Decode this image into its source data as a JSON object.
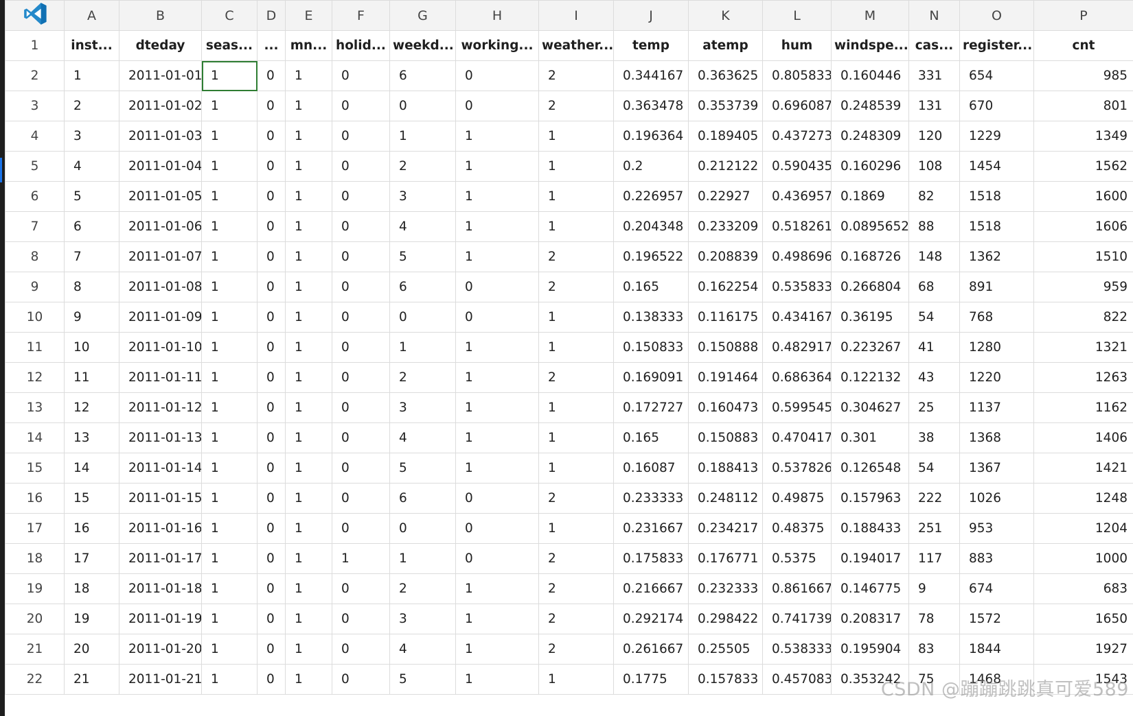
{
  "app_icon": "vscode-logo-icon",
  "accent_color": "#1a73e8",
  "selection_color": "#2e7d32",
  "columns": [
    "A",
    "B",
    "C",
    "D",
    "E",
    "F",
    "G",
    "H",
    "I",
    "J",
    "K",
    "L",
    "M",
    "N",
    "O",
    "P"
  ],
  "headers": [
    "inst...",
    "dteday",
    "seas...",
    "...",
    "mn...",
    "holid...",
    "weekd...",
    "working...",
    "weather...",
    "temp",
    "atemp",
    "hum",
    "windspe...",
    "cas...",
    "register...",
    "cnt"
  ],
  "rows": [
    [
      "1",
      "2011-01-01",
      "1",
      "0",
      "1",
      "0",
      "6",
      "0",
      "2",
      "0.344167",
      "0.363625",
      "0.805833",
      "0.160446",
      "331",
      "654",
      "985"
    ],
    [
      "2",
      "2011-01-02",
      "1",
      "0",
      "1",
      "0",
      "0",
      "0",
      "2",
      "0.363478",
      "0.353739",
      "0.696087",
      "0.248539",
      "131",
      "670",
      "801"
    ],
    [
      "3",
      "2011-01-03",
      "1",
      "0",
      "1",
      "0",
      "1",
      "1",
      "1",
      "0.196364",
      "0.189405",
      "0.437273",
      "0.248309",
      "120",
      "1229",
      "1349"
    ],
    [
      "4",
      "2011-01-04",
      "1",
      "0",
      "1",
      "0",
      "2",
      "1",
      "1",
      "0.2",
      "0.212122",
      "0.590435",
      "0.160296",
      "108",
      "1454",
      "1562"
    ],
    [
      "5",
      "2011-01-05",
      "1",
      "0",
      "1",
      "0",
      "3",
      "1",
      "1",
      "0.226957",
      "0.22927",
      "0.436957",
      "0.1869",
      "82",
      "1518",
      "1600"
    ],
    [
      "6",
      "2011-01-06",
      "1",
      "0",
      "1",
      "0",
      "4",
      "1",
      "1",
      "0.204348",
      "0.233209",
      "0.518261",
      "0.0895652",
      "88",
      "1518",
      "1606"
    ],
    [
      "7",
      "2011-01-07",
      "1",
      "0",
      "1",
      "0",
      "5",
      "1",
      "2",
      "0.196522",
      "0.208839",
      "0.498696",
      "0.168726",
      "148",
      "1362",
      "1510"
    ],
    [
      "8",
      "2011-01-08",
      "1",
      "0",
      "1",
      "0",
      "6",
      "0",
      "2",
      "0.165",
      "0.162254",
      "0.535833",
      "0.266804",
      "68",
      "891",
      "959"
    ],
    [
      "9",
      "2011-01-09",
      "1",
      "0",
      "1",
      "0",
      "0",
      "0",
      "1",
      "0.138333",
      "0.116175",
      "0.434167",
      "0.36195",
      "54",
      "768",
      "822"
    ],
    [
      "10",
      "2011-01-10",
      "1",
      "0",
      "1",
      "0",
      "1",
      "1",
      "1",
      "0.150833",
      "0.150888",
      "0.482917",
      "0.223267",
      "41",
      "1280",
      "1321"
    ],
    [
      "11",
      "2011-01-11",
      "1",
      "0",
      "1",
      "0",
      "2",
      "1",
      "2",
      "0.169091",
      "0.191464",
      "0.686364",
      "0.122132",
      "43",
      "1220",
      "1263"
    ],
    [
      "12",
      "2011-01-12",
      "1",
      "0",
      "1",
      "0",
      "3",
      "1",
      "1",
      "0.172727",
      "0.160473",
      "0.599545",
      "0.304627",
      "25",
      "1137",
      "1162"
    ],
    [
      "13",
      "2011-01-13",
      "1",
      "0",
      "1",
      "0",
      "4",
      "1",
      "1",
      "0.165",
      "0.150883",
      "0.470417",
      "0.301",
      "38",
      "1368",
      "1406"
    ],
    [
      "14",
      "2011-01-14",
      "1",
      "0",
      "1",
      "0",
      "5",
      "1",
      "1",
      "0.16087",
      "0.188413",
      "0.537826",
      "0.126548",
      "54",
      "1367",
      "1421"
    ],
    [
      "15",
      "2011-01-15",
      "1",
      "0",
      "1",
      "0",
      "6",
      "0",
      "2",
      "0.233333",
      "0.248112",
      "0.49875",
      "0.157963",
      "222",
      "1026",
      "1248"
    ],
    [
      "16",
      "2011-01-16",
      "1",
      "0",
      "1",
      "0",
      "0",
      "0",
      "1",
      "0.231667",
      "0.234217",
      "0.48375",
      "0.188433",
      "251",
      "953",
      "1204"
    ],
    [
      "17",
      "2011-01-17",
      "1",
      "0",
      "1",
      "1",
      "1",
      "0",
      "2",
      "0.175833",
      "0.176771",
      "0.5375",
      "0.194017",
      "117",
      "883",
      "1000"
    ],
    [
      "18",
      "2011-01-18",
      "1",
      "0",
      "1",
      "0",
      "2",
      "1",
      "2",
      "0.216667",
      "0.232333",
      "0.861667",
      "0.146775",
      "9",
      "674",
      "683"
    ],
    [
      "19",
      "2011-01-19",
      "1",
      "0",
      "1",
      "0",
      "3",
      "1",
      "2",
      "0.292174",
      "0.298422",
      "0.741739",
      "0.208317",
      "78",
      "1572",
      "1650"
    ],
    [
      "20",
      "2011-01-20",
      "1",
      "0",
      "1",
      "0",
      "4",
      "1",
      "2",
      "0.261667",
      "0.25505",
      "0.538333",
      "0.195904",
      "83",
      "1844",
      "1927"
    ],
    [
      "21",
      "2011-01-21",
      "1",
      "0",
      "1",
      "0",
      "5",
      "1",
      "1",
      "0.1775",
      "0.157833",
      "0.457083",
      "0.353242",
      "75",
      "1468",
      "1543"
    ]
  ],
  "watermark": "CSDN @蹦蹦跳跳真可爱589"
}
